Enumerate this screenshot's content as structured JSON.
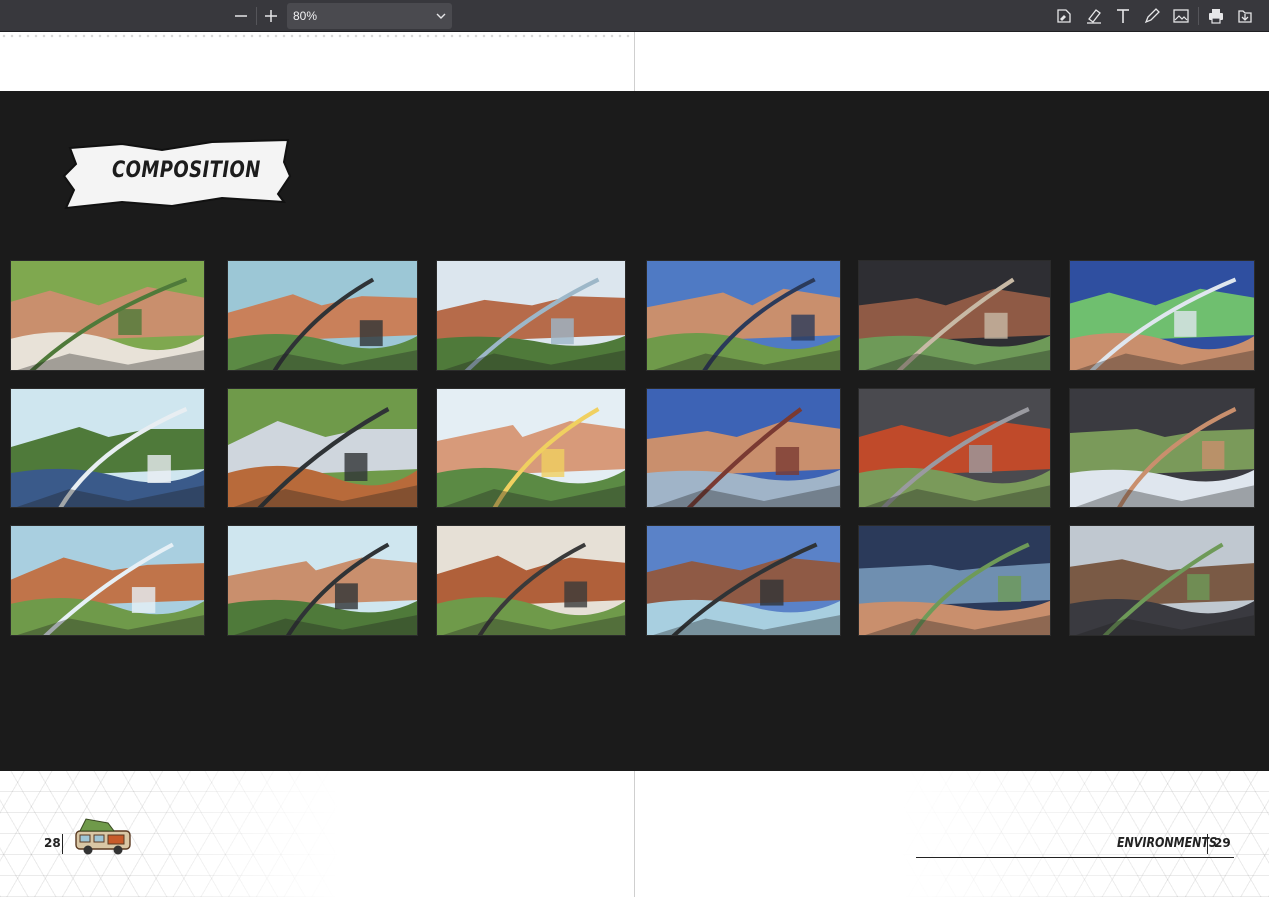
{
  "toolbar": {
    "zoom_out_icon": "minus-icon",
    "zoom_in_icon": "plus-icon",
    "zoom_value": "80%",
    "tools": [
      "sign-icon",
      "highlight-icon",
      "text-icon",
      "draw-icon",
      "image-icon",
      "print-icon",
      "save-icon"
    ]
  },
  "spread": {
    "banner_title": "COMPOSITION",
    "thumbnails": [
      {
        "row": 1,
        "col": 1,
        "palette": [
          "#7fa84f",
          "#c98f6d",
          "#e8e2d8",
          "#4f7a3a"
        ]
      },
      {
        "row": 1,
        "col": 2,
        "palette": [
          "#9cc7d6",
          "#c9805a",
          "#5b8a44",
          "#2f3336"
        ]
      },
      {
        "row": 1,
        "col": 3,
        "palette": [
          "#dce6ee",
          "#b66b4a",
          "#4f7a3a",
          "#9db7c8"
        ]
      },
      {
        "row": 1,
        "col": 4,
        "palette": [
          "#4f7ac4",
          "#c98f6d",
          "#6f9a4a",
          "#2b3a5a"
        ]
      },
      {
        "row": 1,
        "col": 5,
        "palette": [
          "#2e2e33",
          "#8f5a45",
          "#6e9a58",
          "#c7b9a5"
        ]
      },
      {
        "row": 1,
        "col": 6,
        "palette": [
          "#2f4fa0",
          "#6fbf6f",
          "#c98f6d",
          "#dfe6ee"
        ]
      },
      {
        "row": 2,
        "col": 1,
        "palette": [
          "#cfe6ef",
          "#4f7a3a",
          "#3a5a8a",
          "#e8eef2"
        ]
      },
      {
        "row": 2,
        "col": 2,
        "palette": [
          "#6f9a4a",
          "#cfd6dd",
          "#b86a3a",
          "#2f3336"
        ]
      },
      {
        "row": 2,
        "col": 3,
        "palette": [
          "#e4eef4",
          "#d79a7a",
          "#5b8a44",
          "#f0d060"
        ]
      },
      {
        "row": 2,
        "col": 4,
        "palette": [
          "#3d63b5",
          "#c98f6d",
          "#a0b4c8",
          "#7a3a32"
        ]
      },
      {
        "row": 2,
        "col": 5,
        "palette": [
          "#4a4a4f",
          "#c04a2a",
          "#7a9a5a",
          "#9a9aa0"
        ]
      },
      {
        "row": 2,
        "col": 6,
        "palette": [
          "#3a3a40",
          "#7a9a5a",
          "#dfe6ee",
          "#c98f6d"
        ]
      },
      {
        "row": 3,
        "col": 1,
        "palette": [
          "#a9cfe0",
          "#c0744a",
          "#6f9a4a",
          "#e6f0f6"
        ]
      },
      {
        "row": 3,
        "col": 2,
        "palette": [
          "#cfe6ef",
          "#c98f6d",
          "#4f7a3a",
          "#2f3336"
        ]
      },
      {
        "row": 3,
        "col": 3,
        "palette": [
          "#e6e0d6",
          "#b0603a",
          "#6f9a4a",
          "#3a3a3a"
        ]
      },
      {
        "row": 3,
        "col": 4,
        "palette": [
          "#5a82c8",
          "#8f5a45",
          "#a8cfe0",
          "#2f3336"
        ]
      },
      {
        "row": 3,
        "col": 5,
        "palette": [
          "#2b3a5a",
          "#6f8fb0",
          "#c98f6d",
          "#6e9a58"
        ]
      },
      {
        "row": 3,
        "col": 6,
        "palette": [
          "#c0c8d0",
          "#7a5a45",
          "#3a3a40",
          "#6e9a58"
        ]
      }
    ]
  },
  "footer": {
    "left_page_number": "28",
    "right_page_number": "29",
    "section_title": "ENVIRONMENTS"
  }
}
